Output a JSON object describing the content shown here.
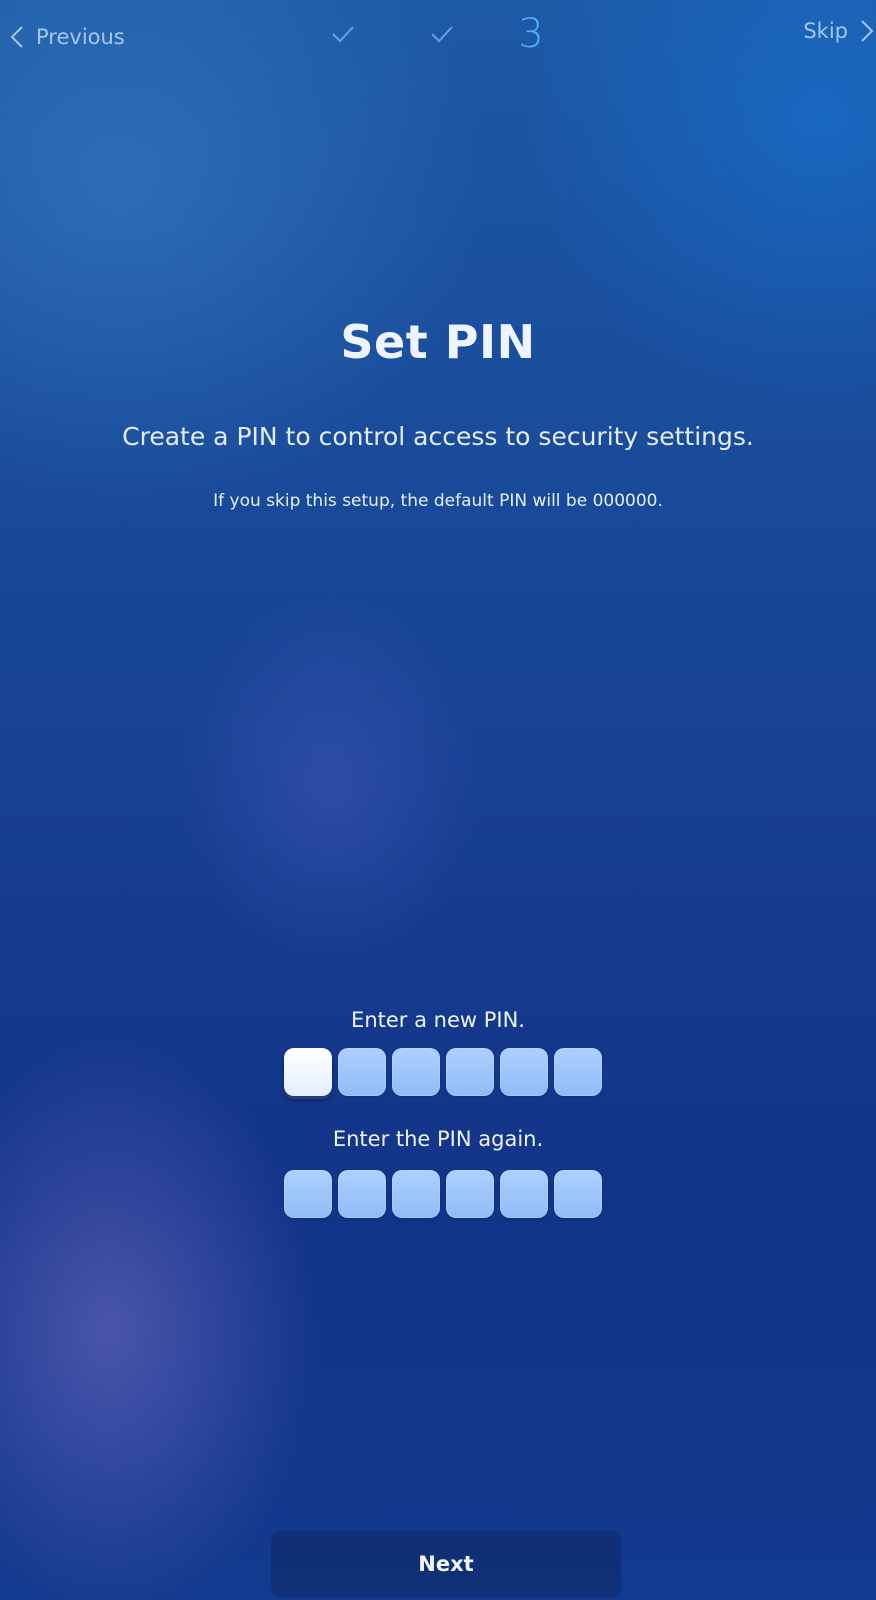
{
  "topbar": {
    "previous_label": "Previous",
    "skip_label": "Skip",
    "current_step": "3",
    "completed_steps": 2
  },
  "main": {
    "title": "Set PIN",
    "subtitle": "Create a PIN to control access to security settings.",
    "note": "If you skip this setup, the default PIN will be 000000."
  },
  "pin_entry": {
    "new_pin_label": "Enter a new PIN.",
    "confirm_pin_label": "Enter the PIN again.",
    "digits": 6,
    "focused_box": 1
  },
  "footer": {
    "next_label": "Next"
  },
  "colors": {
    "accent_step": "#4fb1ff",
    "pin_box": "#9cc6fb",
    "pin_box_focused": "#ffffff"
  },
  "icons": {
    "back": "chevron-left-icon",
    "forward": "chevron-right-icon",
    "done_step": "checkmark-icon"
  }
}
